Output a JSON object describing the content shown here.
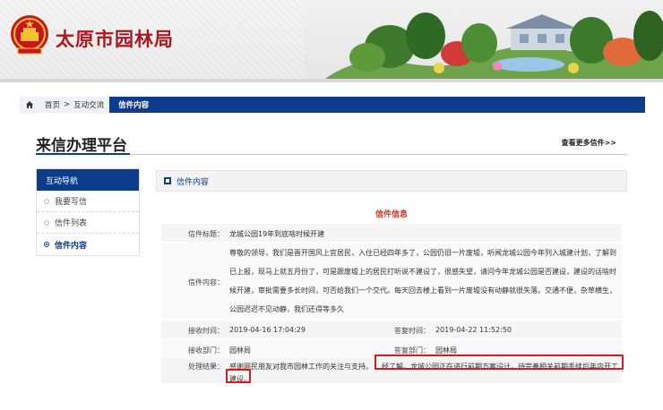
{
  "header": {
    "site_title": "太原市园林局"
  },
  "breadcrumb": {
    "home": "首页",
    "sep": ">",
    "section": "互动交流",
    "current": "信件内容"
  },
  "platform": {
    "title": "来信办理平台",
    "more_link": "查看更多信件>>"
  },
  "sidebar": {
    "heading": "互动导航",
    "items": [
      {
        "label": "我要写信"
      },
      {
        "label": "信件列表"
      },
      {
        "label": "信件内容"
      }
    ]
  },
  "panel": {
    "heading": "信件内容",
    "section_title": "信件信息"
  },
  "letter": {
    "subject_label": "信件标题：",
    "subject": "龙城公园19年到底啥时候开建",
    "content_label": "信件内容：",
    "content": "尊敬的领导，我们是晋开国风上官居民，入住已经四年多了，公园仍旧一片废墟，听闻龙城公园今年列入城建计划，了解到已上报，现马上就五月份了，可是跟废墟上的居民打听说不建设了，很感失望，请问今年龙城公园是否建设，建设的话啥时候开建，审批需要多长时间，可否给我们一个交代。每天回去楼上看到一片废墟没有动静就很失落。交通不便，杂草横生，公园迟迟不见动静，我们还得等多久",
    "received_label": "接收时间：",
    "received": "2019-04-16 17:04:29",
    "replied_label": "答复时间：",
    "replied": "2019-04-22 11:52:50",
    "recv_dept_label": "接收部门：",
    "recv_dept": "园林局",
    "reply_dept_label": "答复部门：",
    "reply_dept": "园林局",
    "result_label": "处理结果：",
    "result_part1": "感谢网民朋友对我市园林工作的关注与支持。",
    "result_part2": "经了解，龙城公园正在进行前期方案设计，待完善相关前期手续后年内开工",
    "result_part3": "建设。"
  },
  "colors": {
    "brand_blue": "#0e3c8c",
    "title_red": "#b0161e",
    "highlight_red": "#d71920"
  }
}
